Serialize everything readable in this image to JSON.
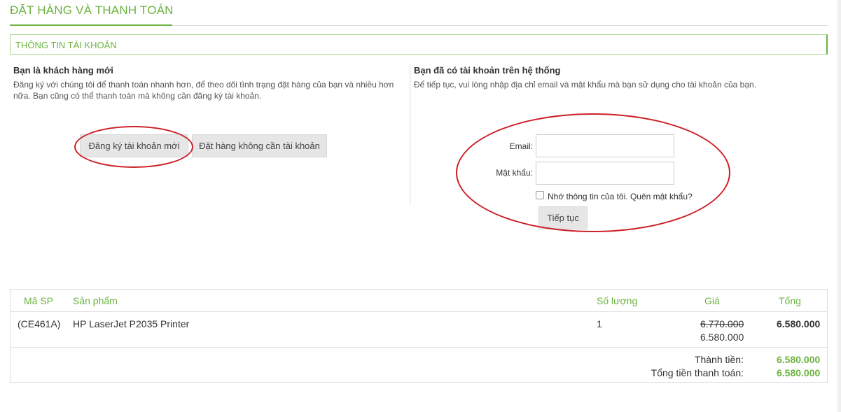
{
  "page": {
    "title": "ĐẶT HÀNG VÀ THANH TOÁN"
  },
  "account_section": {
    "title": "THÔNG TIN TÀI KHOẢN"
  },
  "new_customer": {
    "heading": "Bạn là khách hàng mới",
    "line1": "Đăng ký với chúng tôi để thanh toán nhanh hơn, để theo dõi tình trạng đặt hàng của bạn và nhiều hơn",
    "line2": "nữa. Bạn cũng có thể thanh toán mà không cần đăng ký tài khoản.",
    "register_label": "Đăng ký tài khoản mới",
    "guest_label": "Đặt hàng không cần tài khoản"
  },
  "existing_customer": {
    "heading": "Bạn đã có tài khoản trên hệ thống",
    "description": "Để tiếp tục, vui lòng nhập địa chỉ email và mật khẩu mà bạn sử dụng cho tài khoản của bạn.",
    "email_label": "Email:",
    "email_value": "",
    "password_label": "Mật khẩu:",
    "password_value": "",
    "remember_label": "Nhớ thông tin của tôi. Quên mật khẩu?",
    "continue_label": "Tiếp tục"
  },
  "cart": {
    "headers": {
      "sku": "Mã SP",
      "product": "Sản phẩm",
      "qty": "Số lượng",
      "price": "Giá",
      "total": "Tổng"
    },
    "rows": [
      {
        "sku": "(CE461A)",
        "product": "HP LaserJet P2035 Printer",
        "qty": "1",
        "old_price": "6.770.000",
        "price": "6.580.000",
        "total": "6.580.000"
      }
    ],
    "subtotal_label": "Thành tiền:",
    "subtotal_value": "6.580.000",
    "grand_total_label": "Tổng tiền thanh toán:",
    "grand_total_value": "6.580.000"
  },
  "colors": {
    "accent": "#6cb33f",
    "annotation": "#cc1f26",
    "button_bg": "#e6e6e6"
  },
  "annotations": {
    "shape": "red-ellipse",
    "targets": [
      "register-button",
      "login-form"
    ]
  }
}
